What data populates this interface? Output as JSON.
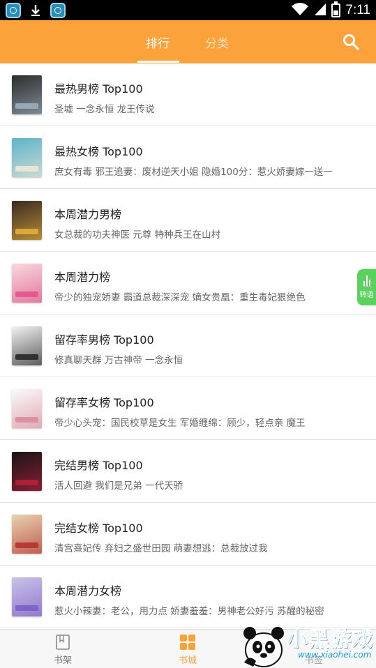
{
  "status_bar": {
    "time": "7:11",
    "icons": [
      "app-notification-icon",
      "download-icon",
      "app-notification-icon",
      "wifi-icon",
      "signal-icon",
      "battery-icon"
    ]
  },
  "header": {
    "tabs": [
      {
        "label": "排行",
        "active": true
      },
      {
        "label": "分类",
        "active": false
      }
    ],
    "accent_color": "#fba23a",
    "search_icon": "search-icon"
  },
  "rankings": [
    {
      "title": "最热男榜 Top100",
      "books": "圣墟 一念永恒 龙王传说",
      "cover_color": "#2d2d2d",
      "cover_accent": "#9fb0c0"
    },
    {
      "title": "最热女榜 Top100",
      "books": "庶女有毒 邪王追妻：废材逆天小姐 隐婚100分：惹火娇妻嫁一送一",
      "cover_color": "#5fb3c9",
      "cover_accent": "#f2e9d8"
    },
    {
      "title": "本周潜力男榜",
      "books": "女总裁的功夫神医 元尊 特种兵王在山村",
      "cover_color": "#3a2a22",
      "cover_accent": "#e8b33c"
    },
    {
      "title": "本周潜力榜",
      "books": "帝少的独宠娇妻 霸道总裁深深宠 嫡女贵凰：重生毒妃狠绝色",
      "cover_color": "#f6d9dc",
      "cover_accent": "#e0518a"
    },
    {
      "title": "留存率男榜 Top100",
      "books": "修真聊天群 万古神帝 一念永恒",
      "cover_color": "#f2f2f2",
      "cover_accent": "#222222"
    },
    {
      "title": "留存率女榜 Top100",
      "books": "帝少心头宠：国民校草是女生 军婚缠绵：顾少，轻点亲 魔王",
      "cover_color": "#fafafa",
      "cover_accent": "#d88a9a"
    },
    {
      "title": "完结男榜 Top100",
      "books": "活人回避 我们是兄弟 一代天骄",
      "cover_color": "#1a1418",
      "cover_accent": "#b5233a"
    },
    {
      "title": "完结女榜 Top100",
      "books": "清宫熹妃传 弃妇之盛世田园 萌妻想逃：总裁放过我",
      "cover_color": "#e8d2b0",
      "cover_accent": "#b0302a"
    },
    {
      "title": "本周潜力女榜",
      "books": "惹火小辣妻：老公，用力点 娇妻羞羞：男神老公好污 苏醒的秘密",
      "cover_color": "#c9c2e8",
      "cover_accent": "#7a5cc4"
    }
  ],
  "side_tab": {
    "label": "转语"
  },
  "bottom_nav": {
    "items": [
      {
        "label": "书架",
        "icon": "bookshelf-icon",
        "active": false
      },
      {
        "label": "书城",
        "icon": "bookstore-grid-icon",
        "active": true
      },
      {
        "label": "书签",
        "icon": "bookmark-icon",
        "active": false
      }
    ]
  },
  "watermark": {
    "text": "小黑游戏",
    "url": "www.xiaohei.com"
  }
}
